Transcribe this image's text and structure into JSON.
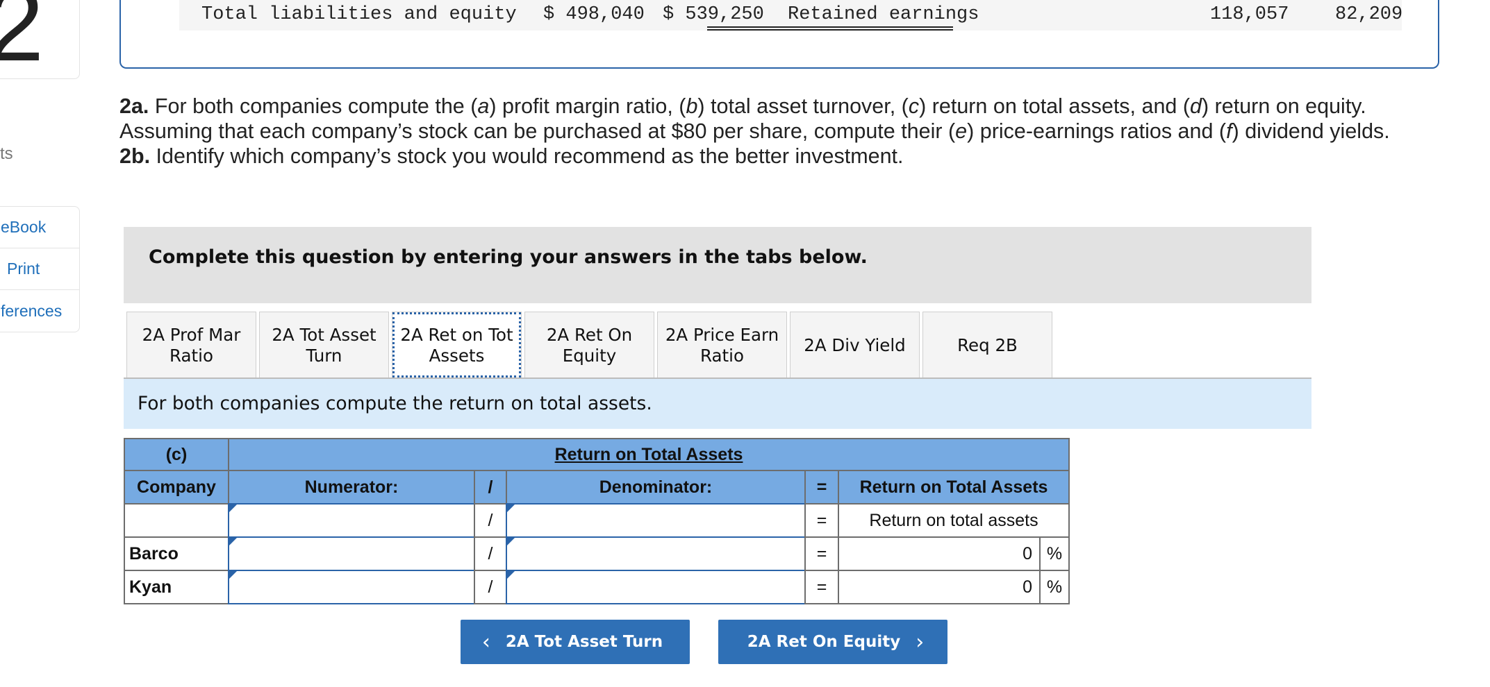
{
  "sidebar": {
    "question_number": "2",
    "points_label": "ts",
    "tools": [
      "eBook",
      "Print",
      "ferences"
    ]
  },
  "balance_sheet": {
    "label": "Total liabilities and equity",
    "value_1": "$ 498,040",
    "value_2": "$ 539,250",
    "right_label": "Retained earnings",
    "right_value_1": "118,057",
    "right_value_2": "82,209"
  },
  "question": {
    "p1_bold": "2a.",
    "p1_a": " For both companies compute the (",
    "p1_a_it": "a",
    "p1_b": ") profit margin ratio, (",
    "p1_b_it": "b",
    "p1_c": ") total asset turnover, (",
    "p1_c_it": "c",
    "p1_d": ") return on total assets, and (",
    "p1_d_it": "d",
    "p1_e": ") return on equity. Assuming that each company’s stock can be purchased at $80 per share, compute their (",
    "p1_e_it": "e",
    "p1_f": ") price-earnings ratios and (",
    "p1_f_it": "f",
    "p1_g": ") dividend yields.",
    "p2_bold": "2b.",
    "p2": " Identify which company’s stock you would recommend as the better investment."
  },
  "instructions": "Complete this question by entering your answers in the tabs below.",
  "tabs": [
    {
      "line1": "2A Prof Mar",
      "line2": "Ratio"
    },
    {
      "line1": "2A Tot Asset",
      "line2": "Turn"
    },
    {
      "line1": "2A Ret on Tot",
      "line2": "Assets"
    },
    {
      "line1": "2A Ret On",
      "line2": "Equity"
    },
    {
      "line1": "2A Price Earn",
      "line2": "Ratio"
    },
    {
      "line1": "2A Div Yield",
      "line2": ""
    },
    {
      "line1": "Req 2B",
      "line2": ""
    }
  ],
  "tab_description": "For both companies compute the return on total assets.",
  "table": {
    "header_c": "(c)",
    "header_title": "Return on Total Assets",
    "col_company": "Company",
    "col_numerator": "Numerator:",
    "col_divide": "/",
    "col_denominator": "Denominator:",
    "col_equals": "=",
    "col_result": "Return on Total Assets",
    "row0_result": "Return on total assets",
    "rows": [
      {
        "company": "Barco",
        "value": "0",
        "unit": "%"
      },
      {
        "company": "Kyan",
        "value": "0",
        "unit": "%"
      }
    ],
    "divide": "/",
    "equals": "="
  },
  "nav": {
    "prev_label": "2A Tot Asset Turn",
    "next_label": "2A Ret On Equity",
    "prev_icon": "chevron-left-icon",
    "next_icon": "chevron-right-icon"
  },
  "colors": {
    "header_blue": "#76aae2",
    "button_blue": "#2f70b6",
    "desc_band": "#d9ebfa"
  }
}
